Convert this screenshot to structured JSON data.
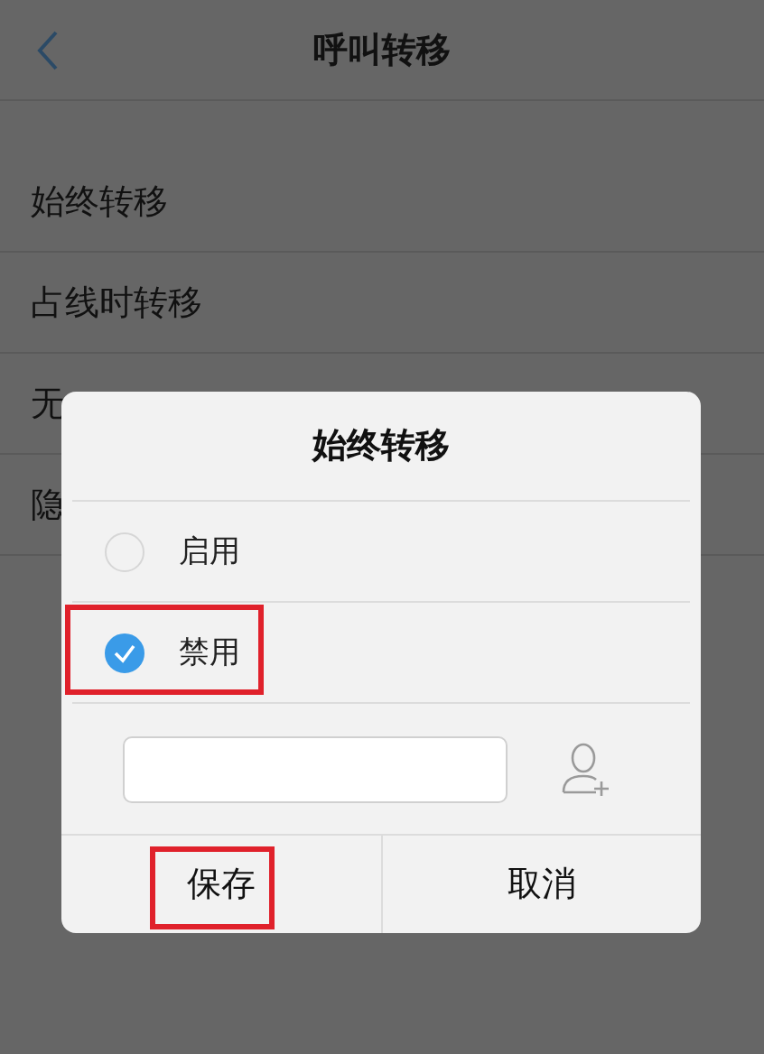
{
  "header": {
    "title": "呼叫转移"
  },
  "list": [
    {
      "label": "始终转移"
    },
    {
      "label": "占线时转移"
    },
    {
      "label": "无"
    },
    {
      "label": "隐"
    }
  ],
  "dialog": {
    "title": "始终转移",
    "options": [
      {
        "label": "启用",
        "selected": false,
        "highlighted": false
      },
      {
        "label": "禁用",
        "selected": true,
        "highlighted": true
      }
    ],
    "buttons": [
      {
        "label": "保存",
        "highlighted": true
      },
      {
        "label": "取消",
        "highlighted": false
      }
    ]
  }
}
